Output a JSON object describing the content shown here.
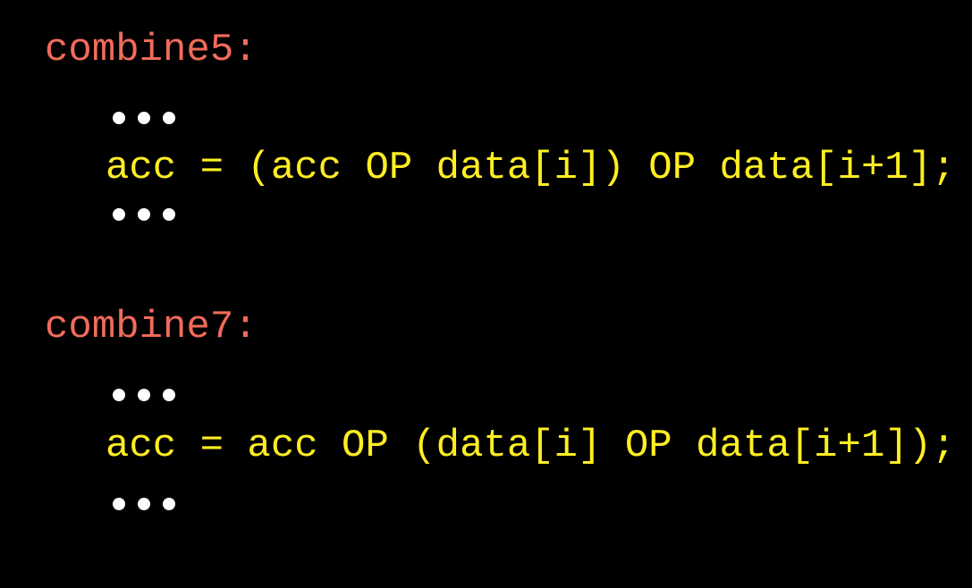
{
  "blocks": [
    {
      "label": "combine5:",
      "code": "acc = (acc OP data[i]) OP data[i+1];"
    },
    {
      "label": "combine7:",
      "code": "acc = acc OP (data[i] OP data[i+1]);"
    }
  ],
  "colors": {
    "background": "#000000",
    "label": "#f26b5b",
    "code": "#ffee22",
    "ellipsis": "#ffffff"
  }
}
